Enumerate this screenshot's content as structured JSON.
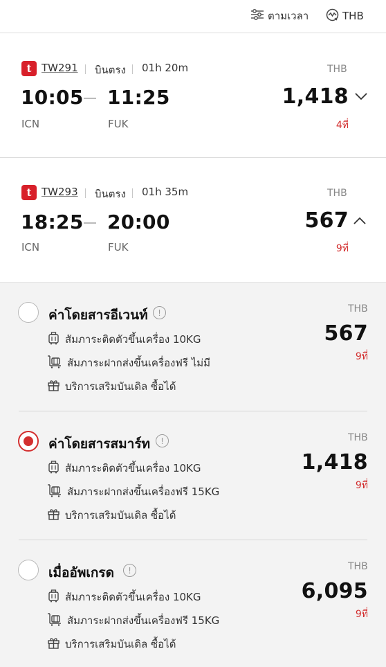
{
  "toolbar": {
    "sort_label": "ตามเวลา",
    "currency_label": "THB"
  },
  "flights": [
    {
      "flight_number": "TW291",
      "type": "บินตรง",
      "duration": "01h 20m",
      "depart_time": "10:05",
      "arrive_time": "11:25",
      "from": "ICN",
      "to": "FUK",
      "currency": "THB",
      "price": "1,418",
      "seats": "4ที่",
      "expanded": false
    },
    {
      "flight_number": "TW293",
      "type": "บินตรง",
      "duration": "01h 35m",
      "depart_time": "18:25",
      "arrive_time": "20:00",
      "from": "ICN",
      "to": "FUK",
      "currency": "THB",
      "price": "567",
      "seats": "9ที่",
      "expanded": true
    }
  ],
  "fares": [
    {
      "name": "ค่าโดยสารอีเวนท์",
      "selected": false,
      "carry_on": "สัมภาระติดตัวขึ้นเครื่อง 10KG",
      "checked": "สัมภาระฝากส่งขึ้นเครื่องฟรี ไม่มี",
      "entertainment": "บริการเสริมบันเดิล ซื้อได้",
      "currency": "THB",
      "price": "567",
      "seats": "9ที่"
    },
    {
      "name": "ค่าโดยสารสมาร์ท",
      "selected": true,
      "carry_on": "สัมภาระติดตัวขึ้นเครื่อง 10KG",
      "checked": "สัมภาระฝากส่งขึ้นเครื่องฟรี 15KG",
      "entertainment": "บริการเสริมบันเดิล ซื้อได้",
      "currency": "THB",
      "price": "1,418",
      "seats": "9ที่"
    },
    {
      "name": "เมื่ออัพเกรด",
      "selected": false,
      "carry_on": "สัมภาระติดตัวขึ้นเครื่อง 10KG",
      "checked": "สัมภาระฝากส่งขึ้นเครื่องฟรี 15KG",
      "entertainment": "บริการเสริมบันเดิล ซื้อได้",
      "currency": "THB",
      "price": "6,095",
      "seats": "9ที่"
    }
  ],
  "icons": {
    "sort": "sliders-icon",
    "currency": "currency-exchange-icon",
    "carry_on": "carry-on-bag-icon",
    "checked": "checked-baggage-icon",
    "entertainment": "gift-icon",
    "info": "info-icon",
    "expand": "chevron-down-icon",
    "collapse": "chevron-up-icon",
    "airline_logo": "airline-logo"
  },
  "colors": {
    "accent_red": "#d32f2f",
    "logo_red": "#d8202a",
    "panel_bg": "#f3f3f3"
  }
}
